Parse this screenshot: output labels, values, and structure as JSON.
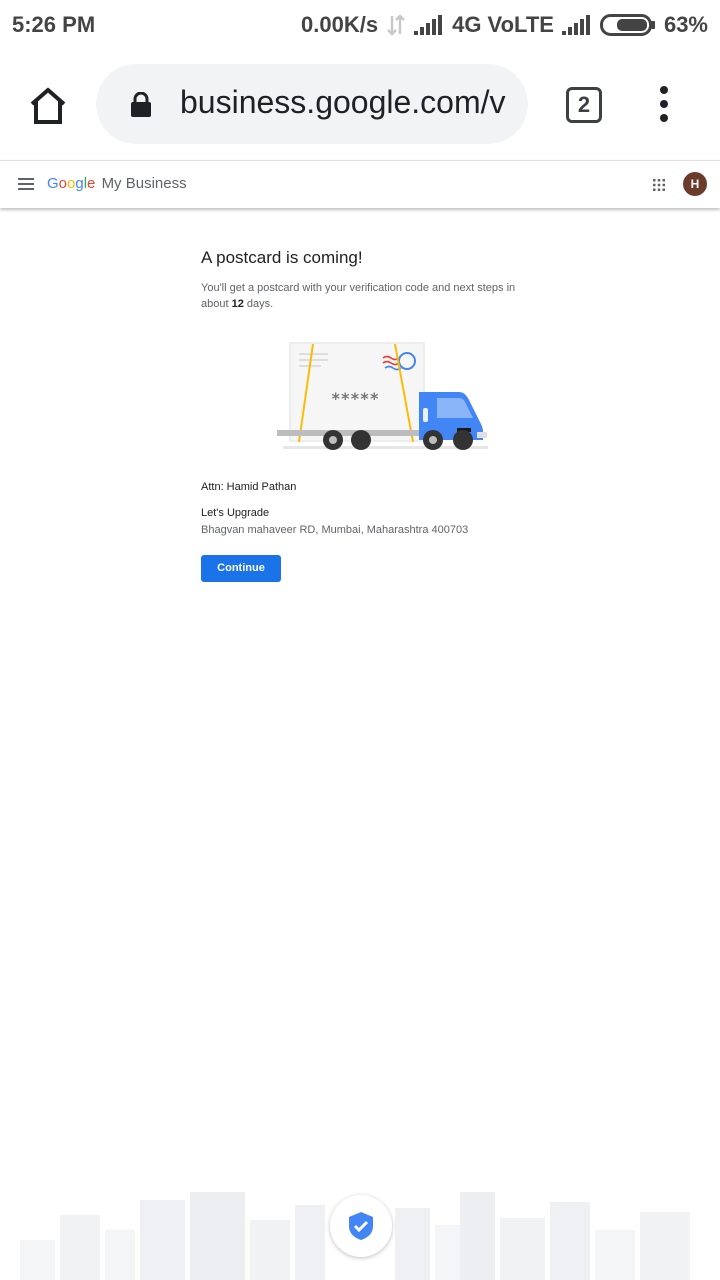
{
  "status_bar": {
    "time": "5:26 PM",
    "net_speed": "0.00K/s",
    "network": "4G VoLTE",
    "battery": "63%"
  },
  "browser": {
    "url": "business.google.com/v",
    "tab_count": "2",
    "icons": [
      "home-icon",
      "lock-icon",
      "tabs-icon",
      "more-vert-icon"
    ]
  },
  "header": {
    "brand_letters": [
      "G",
      "o",
      "o",
      "g",
      "l",
      "e"
    ],
    "brand_colors": [
      "#4285F4",
      "#EA4335",
      "#FBBC05",
      "#4285F4",
      "#34A853",
      "#EA4335"
    ],
    "product": "My Business",
    "avatar_initial": "H"
  },
  "main": {
    "title": "A postcard is coming!",
    "desc_prefix": "You'll get a postcard with your verification code and next steps in about",
    "days": "12",
    "desc_suffix": "days.",
    "postcard_code": "*****",
    "attn": "Attn: Hamid Pathan",
    "business_name": "Let's Upgrade",
    "address": "Bhagvan mahaveer RD, Mumbai, Maharashtra 400703",
    "continue_label": "Continue"
  },
  "colors": {
    "accent": "#1a73e8",
    "truck_blue": "#4285f4",
    "avatar_bg": "#6d3b2c"
  }
}
